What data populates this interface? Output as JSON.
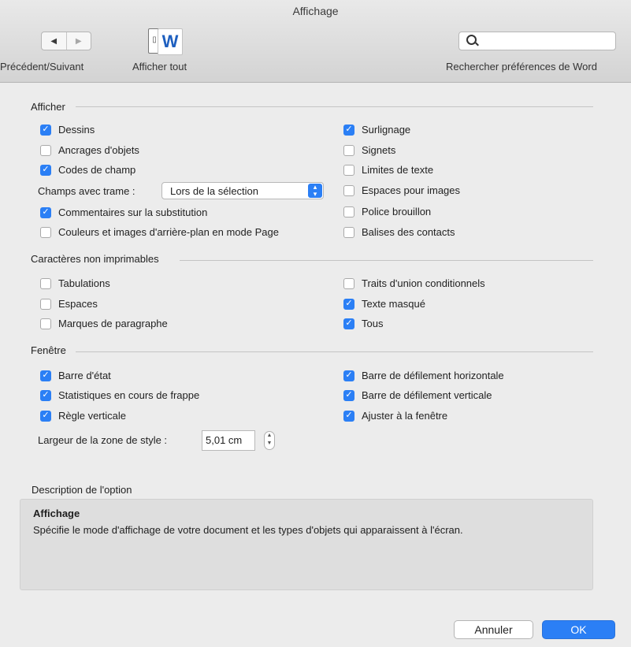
{
  "window": {
    "title": "Affichage"
  },
  "toolbar": {
    "prev_icon": "triangle-left-icon",
    "next_icon": "triangle-right-icon",
    "prev_next_label": "Précédent/Suivant",
    "show_all_label": "Afficher tout",
    "word_icon_letter": "W",
    "search_placeholder": "",
    "search_label": "Rechercher préférences de Word"
  },
  "sections": {
    "afficher": {
      "title": "Afficher",
      "left": [
        {
          "label": "Dessins",
          "checked": true
        },
        {
          "label": "Ancrages d'objets",
          "checked": false
        },
        {
          "label": "Codes de champ",
          "checked": true
        }
      ],
      "trame_label": "Champs avec trame :",
      "trame_value": "Lors de la sélection",
      "left2": [
        {
          "label": "Commentaires sur la substitution",
          "checked": true
        },
        {
          "label": "Couleurs et images d'arrière-plan en mode Page",
          "checked": false
        }
      ],
      "right": [
        {
          "label": "Surlignage",
          "checked": true
        },
        {
          "label": "Signets",
          "checked": false
        },
        {
          "label": "Limites de texte",
          "checked": false
        },
        {
          "label": "Espaces pour images",
          "checked": false
        },
        {
          "label": "Police brouillon",
          "checked": false
        },
        {
          "label": "Balises des contacts",
          "checked": false
        }
      ]
    },
    "caracteres": {
      "title": "Caractères non imprimables",
      "left": [
        {
          "label": "Tabulations",
          "checked": false
        },
        {
          "label": "Espaces",
          "checked": false
        },
        {
          "label": "Marques de paragraphe",
          "checked": false
        }
      ],
      "right": [
        {
          "label": "Traits d'union conditionnels",
          "checked": false
        },
        {
          "label": "Texte masqué",
          "checked": true
        },
        {
          "label": "Tous",
          "checked": true
        }
      ]
    },
    "fenetre": {
      "title": "Fenêtre",
      "left": [
        {
          "label": "Barre d'état",
          "checked": true
        },
        {
          "label": "Statistiques en cours de frappe",
          "checked": true
        },
        {
          "label": "Règle verticale",
          "checked": true
        }
      ],
      "right": [
        {
          "label": "Barre de défilement horizontale",
          "checked": true
        },
        {
          "label": "Barre de défilement verticale",
          "checked": true
        },
        {
          "label": "Ajuster à la fenêtre",
          "checked": true
        }
      ],
      "style_width_label": "Largeur de la zone de style :",
      "style_width_value": "5,01 cm"
    }
  },
  "description": {
    "title": "Description de l'option",
    "heading": "Affichage",
    "text": "Spécifie le mode d'affichage de votre document et les types d'objets qui apparaissent à l'écran."
  },
  "buttons": {
    "cancel": "Annuler",
    "ok": "OK"
  },
  "colors": {
    "accent": "#2b7ff5",
    "window_bg": "#ececec"
  }
}
